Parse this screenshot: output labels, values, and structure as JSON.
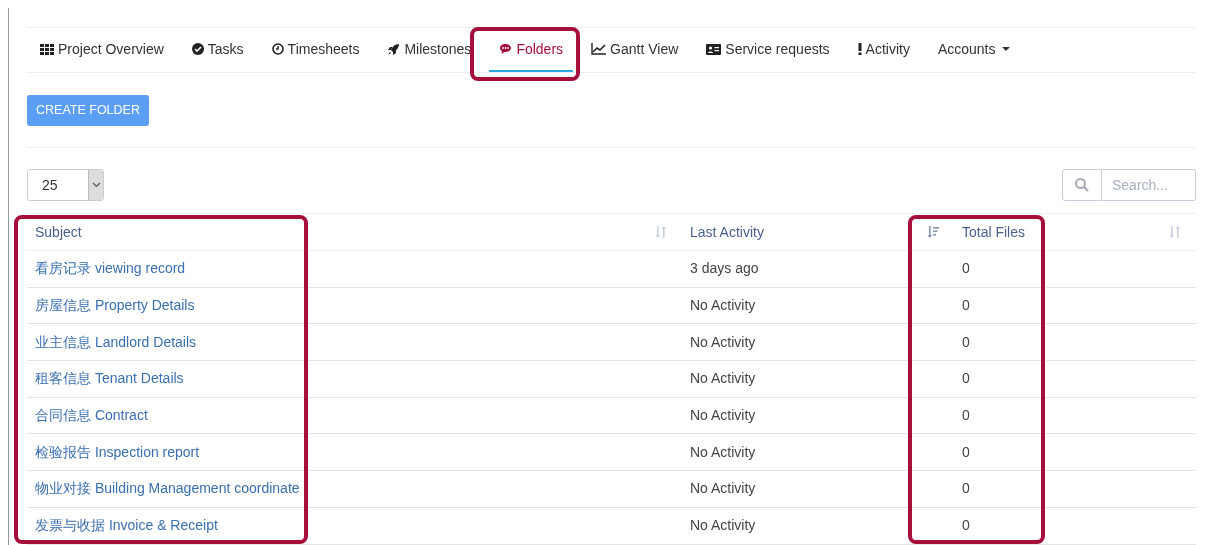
{
  "tabs": [
    {
      "label": "Project Overview",
      "selected": false
    },
    {
      "label": "Tasks",
      "selected": false
    },
    {
      "label": "Timesheets",
      "selected": false
    },
    {
      "label": "Milestones",
      "selected": false
    },
    {
      "label": "Folders",
      "selected": true
    },
    {
      "label": "Gantt View",
      "selected": false
    },
    {
      "label": "Service requests",
      "selected": false
    },
    {
      "label": "Activity",
      "selected": false
    },
    {
      "label": "Accounts",
      "selected": false,
      "dropdown": true
    }
  ],
  "create_button": "CREATE FOLDER",
  "page_size": "25",
  "search": {
    "placeholder": "Search..."
  },
  "table": {
    "columns": [
      {
        "label": "Subject",
        "sorted": false
      },
      {
        "label": "Last Activity",
        "sorted": true
      },
      {
        "label": "Total Files",
        "sorted": false
      }
    ],
    "rows": [
      [
        "看房记录 viewing record",
        "3 days ago",
        "0"
      ],
      [
        "房屋信息 Property Details",
        "No Activity",
        "0"
      ],
      [
        "业主信息 Landlord Details",
        "No Activity",
        "0"
      ],
      [
        "租客信息 Tenant Details",
        "No Activity",
        "0"
      ],
      [
        "合同信息 Contract",
        "No Activity",
        "0"
      ],
      [
        "检验报告 Inspection report",
        "No Activity",
        "0"
      ],
      [
        "物业对接 Building Management coordinate",
        "No Activity",
        "0"
      ],
      [
        "发票与收据 Invoice & Receipt",
        "No Activity",
        "0"
      ]
    ]
  }
}
